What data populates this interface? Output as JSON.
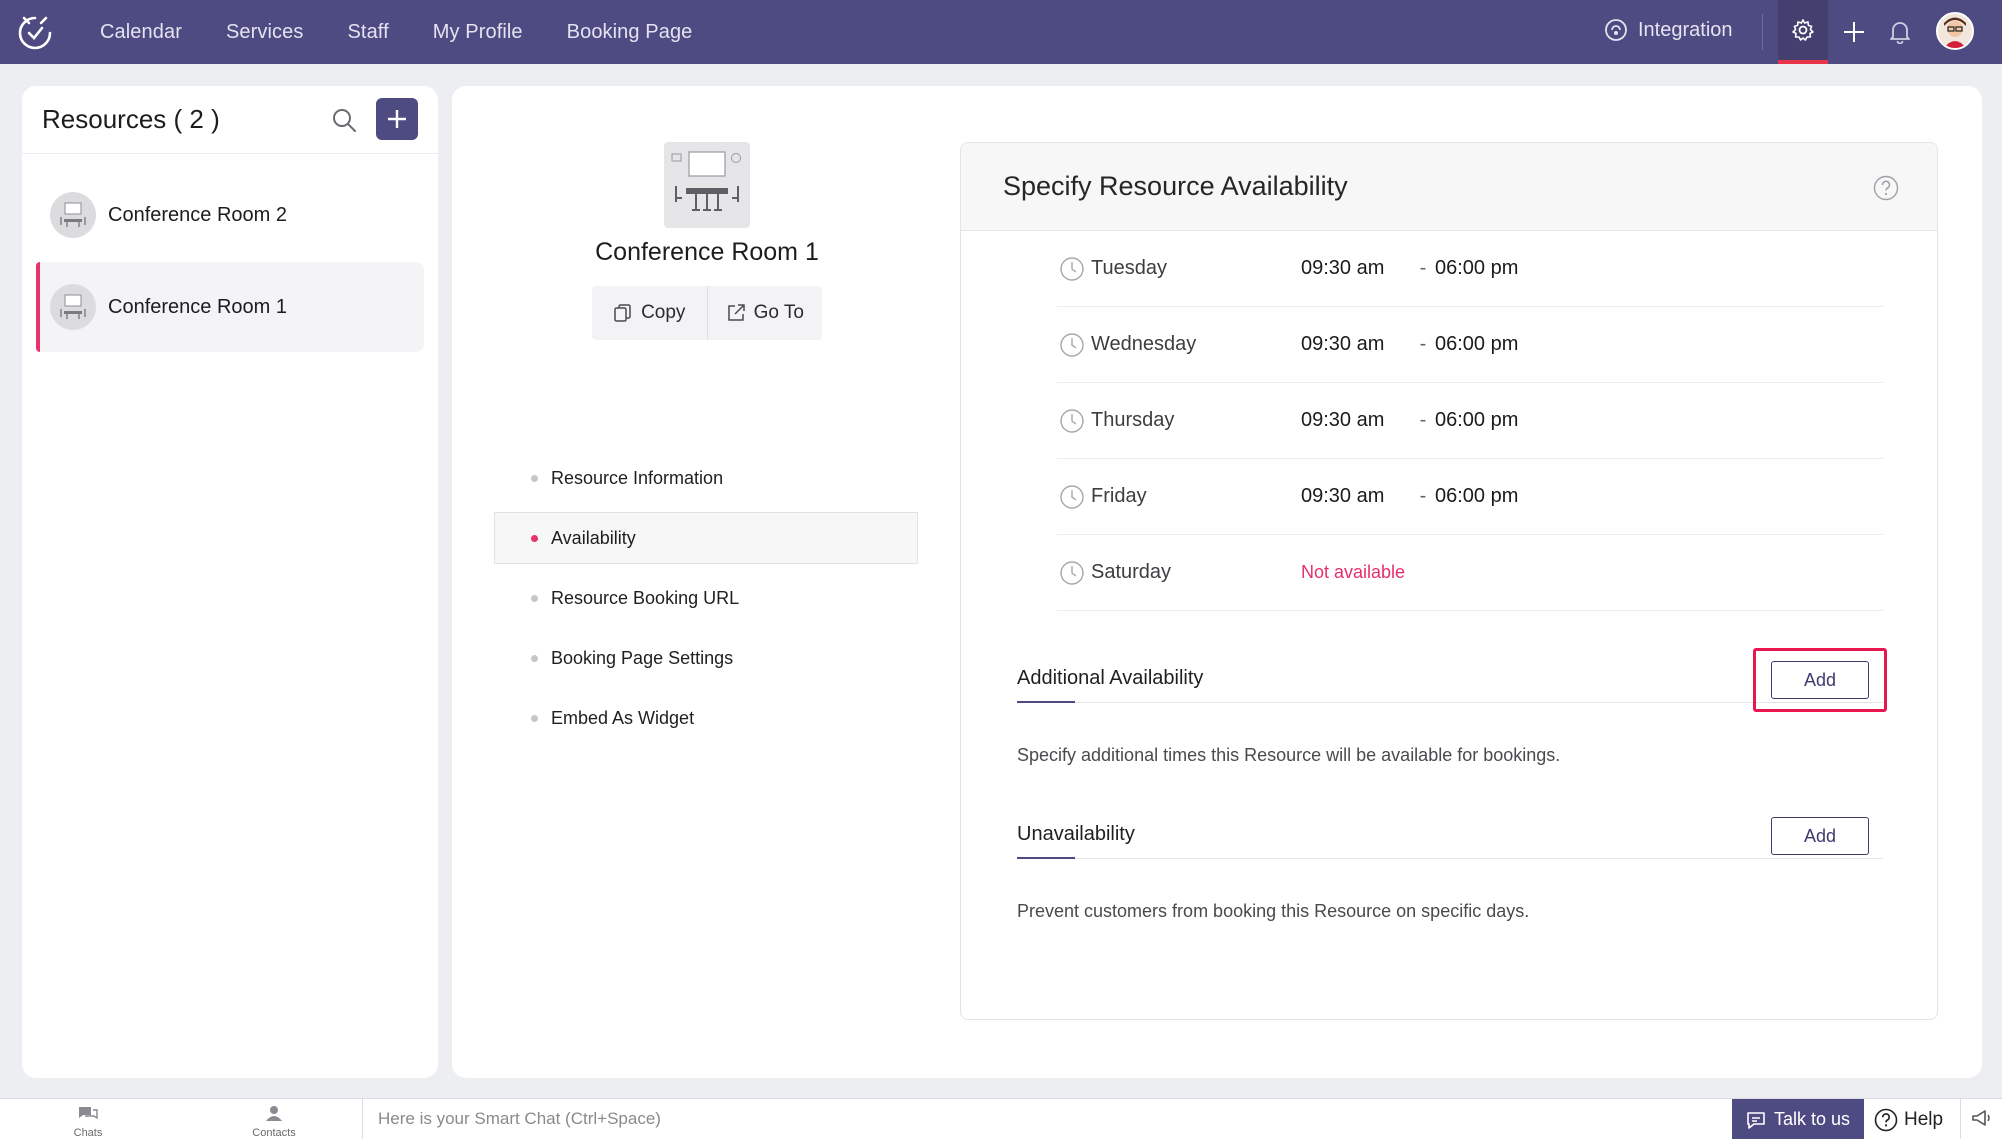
{
  "nav": {
    "links": [
      "Calendar",
      "Services",
      "Staff",
      "My Profile",
      "Booking Page"
    ],
    "integration": "Integration"
  },
  "sidebar": {
    "title": "Resources ( 2 )",
    "items": [
      {
        "name": "Conference Room 2",
        "active": false
      },
      {
        "name": "Conference Room 1",
        "active": true
      }
    ]
  },
  "resource": {
    "title": "Conference Room 1",
    "copy_label": "Copy",
    "goto_label": "Go To",
    "menu": [
      {
        "label": "Resource Information",
        "active": false
      },
      {
        "label": "Availability",
        "active": true
      },
      {
        "label": "Resource Booking URL",
        "active": false
      },
      {
        "label": "Booking Page Settings",
        "active": false
      },
      {
        "label": "Embed As Widget",
        "active": false
      }
    ]
  },
  "availability": {
    "title": "Specify Resource Availability",
    "days": [
      {
        "day": "Tuesday",
        "from": "09:30 am",
        "sep": "-",
        "to": "06:00 pm"
      },
      {
        "day": "Wednesday",
        "from": "09:30 am",
        "sep": "-",
        "to": "06:00 pm"
      },
      {
        "day": "Thursday",
        "from": "09:30 am",
        "sep": "-",
        "to": "06:00 pm"
      },
      {
        "day": "Friday",
        "from": "09:30 am",
        "sep": "-",
        "to": "06:00 pm"
      },
      {
        "day": "Saturday",
        "status": "Not available"
      }
    ],
    "additional": {
      "title": "Additional Availability",
      "add_label": "Add",
      "description": "Specify additional times this Resource will be available for bookings."
    },
    "unavailability": {
      "title": "Unavailability",
      "add_label": "Add",
      "description": "Prevent customers from booking this Resource on specific days."
    }
  },
  "bottom": {
    "chats": "Chats",
    "contacts": "Contacts",
    "chat_placeholder": "Here is your Smart Chat (Ctrl+Space)",
    "talk": "Talk to us",
    "help": "Help"
  },
  "colors": {
    "nav_bg": "#4e4a82",
    "accent_pink": "#e8336a",
    "highlight_red": "#e8164f"
  }
}
